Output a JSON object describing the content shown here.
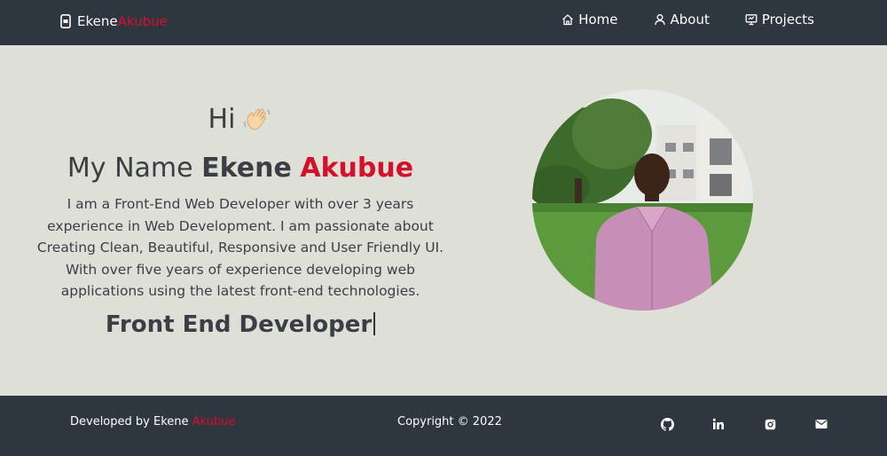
{
  "nav": {
    "brand_first": "Ekene",
    "brand_last": "Akubue",
    "brand_icon": "mobile-phone-icon",
    "links": [
      {
        "label": "Home",
        "icon": "home-icon"
      },
      {
        "label": "About",
        "icon": "user-icon"
      },
      {
        "label": "Projects",
        "icon": "presentation-icon"
      }
    ]
  },
  "hero": {
    "greeting": "Hi",
    "wave_emoji": "👋🏻",
    "name_prefix": "My Name",
    "name_first": "Ekene",
    "name_last": "Akubue",
    "bio": "I am a Front-End Web Developer with over 3 years experience in Web Development. I am passionate about Creating Clean, Beautiful, Responsive and User Friendly UI. With over five years of experience developing web applications using the latest front-end technologies.",
    "role": "Front End Developer"
  },
  "footer": {
    "credit_prefix": "Developed by Ekene",
    "credit_last": "Akubue",
    "copyright": "Copyright © 2022",
    "socials": [
      "github-icon",
      "linkedin-icon",
      "instagram-icon",
      "mail-icon"
    ]
  },
  "colors": {
    "nav_bg": "#2e3640",
    "page_bg": "#dedfd7",
    "accent": "#d4102a",
    "text": "#3a3f46"
  }
}
